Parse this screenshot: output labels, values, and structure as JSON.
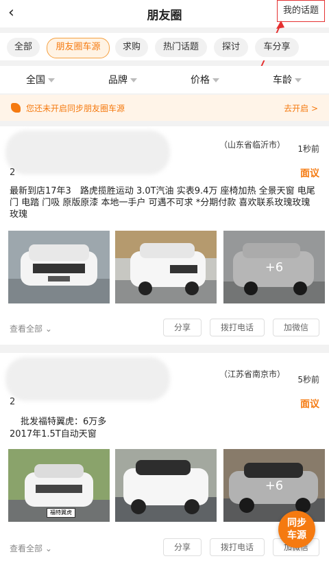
{
  "header": {
    "back_icon": "‹",
    "title": "朋友圈",
    "my_topics": "我的话题"
  },
  "chips": [
    "全部",
    "朋友圈车源",
    "求购",
    "热门话题",
    "探讨",
    "车分享"
  ],
  "filters": [
    "全国",
    "品牌",
    "价格",
    "车龄"
  ],
  "banner": {
    "text": "您还未开启同步朋友圈车源",
    "action": "去开启 >"
  },
  "posts": [
    {
      "location": "（山东省临沂市）",
      "time": "1秒前",
      "price": "面议",
      "first_digit": "2",
      "description": "最新到店17年3　路虎揽胜运动 3.0T汽油  实表9.4万 座椅加热 全景天窗 电尾门 电踏 门吸 原版原漆 本地一手户 可遇不可求 *分期付款 喜欢联系玫瑰玫瑰玫瑰",
      "more_count": "+6",
      "see_all": "查看全部 ⌄",
      "actions": [
        "分享",
        "拨打电话",
        "加微信"
      ]
    },
    {
      "location": "（江苏省南京市）",
      "time": "5秒前",
      "price": "面议",
      "first_digit": "2",
      "description_line1": "批发福特翼虎：6万多",
      "description_line2": "2017年1.5T自动天窗",
      "more_count": "+6",
      "see_all": "查看全部 ⌄",
      "actions": [
        "分享",
        "拨打电话",
        "加微信"
      ],
      "plate_label": "福特翼虎"
    }
  ],
  "fab": {
    "line1": "同步",
    "line2": "车源"
  },
  "colors": {
    "accent": "#f57a10",
    "highlight": "#e53030"
  }
}
